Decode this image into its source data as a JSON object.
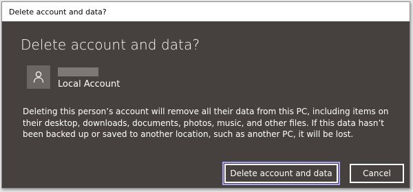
{
  "window": {
    "title": "Delete account and data?"
  },
  "dialog": {
    "heading": "Delete account and data?",
    "account": {
      "avatar_icon": "person-icon",
      "type": "Local Account"
    },
    "description": "Deleting this person’s account will remove all their data from this PC, including items on their desktop, downloads, documents, photos, music, and other files. If this data hasn’t been backed up or saved to another location, such as another PC, it will be lost.",
    "buttons": {
      "delete_label": "Delete account and data",
      "cancel_label": "Cancel"
    }
  },
  "colors": {
    "dialog_background": "#46413e",
    "focus_ring": "#a7a3f4",
    "text": "#ffffff"
  }
}
